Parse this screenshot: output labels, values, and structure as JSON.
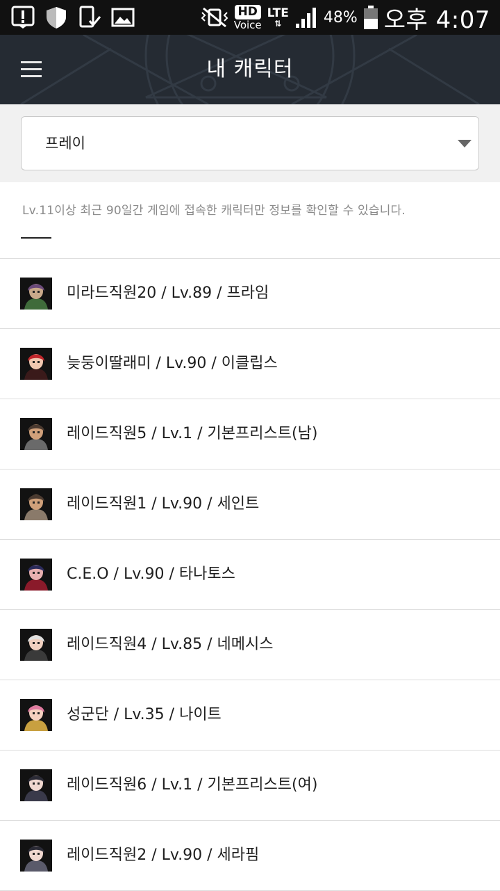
{
  "status_bar": {
    "hd": "HD",
    "voice": "Voice",
    "lte": "LTE",
    "lte_arrows": "⇅",
    "battery": "48%",
    "time": "오후 4:07"
  },
  "header": {
    "title": "내 캐릭터",
    "colors": {
      "background": "#252b33",
      "text": "#ffffff"
    }
  },
  "server_select": {
    "value": "프레이"
  },
  "notice": "Lv.11이상 최근 90일간 게임에 접속한 캐릭터만 정보를 확인할 수 있습니다.",
  "characters": [
    {
      "label": "미라드직원20 / Lv.89 / 프라임",
      "avatar_colors": [
        "#6b4a7a",
        "#c9a98a",
        "#3f6b3a"
      ]
    },
    {
      "label": "늦둥이딸래미 / Lv.90 / 이클립스",
      "avatar_colors": [
        "#c0262b",
        "#f0c7b0",
        "#3a1a1a"
      ]
    },
    {
      "label": "레이드직원5 / Lv.1 / 기본프리스트(남)",
      "avatar_colors": [
        "#4a3a30",
        "#d0a07a",
        "#6a6a6a"
      ]
    },
    {
      "label": "레이드직원1 / Lv.90 / 세인트",
      "avatar_colors": [
        "#4a3a30",
        "#d0a07a",
        "#8a7a6a"
      ]
    },
    {
      "label": "C.E.O / Lv.90 / 타나토스",
      "avatar_colors": [
        "#2a2a5a",
        "#e8b0b0",
        "#8a1a2a"
      ]
    },
    {
      "label": "레이드직원4 / Lv.85 / 네메시스",
      "avatar_colors": [
        "#e0e0e0",
        "#f0d0c0",
        "#3a3a3a"
      ]
    },
    {
      "label": "성군단 / Lv.35 / 나이트",
      "avatar_colors": [
        "#e07aa0",
        "#f5d0c0",
        "#c8a040"
      ]
    },
    {
      "label": "레이드직원6 / Lv.1 / 기본프리스트(여)",
      "avatar_colors": [
        "#2a2a35",
        "#f0d8d0",
        "#3a3a4a"
      ]
    },
    {
      "label": "레이드직원2 / Lv.90 / 세라핌",
      "avatar_colors": [
        "#2a2a35",
        "#f0d8d0",
        "#5a5a6a"
      ]
    }
  ]
}
